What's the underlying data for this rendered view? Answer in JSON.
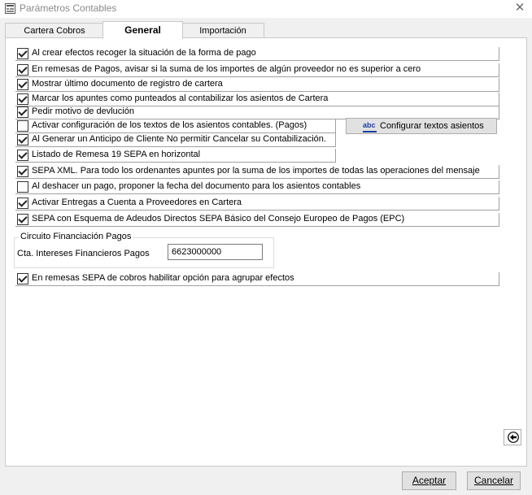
{
  "window": {
    "title": "Parámetros Contables",
    "close_icon": "close-icon",
    "app_icon": "app-icon"
  },
  "tabs": [
    {
      "label": "Cartera Cobros",
      "active": false
    },
    {
      "label": "General",
      "active": true
    },
    {
      "label": "Importación",
      "active": false
    }
  ],
  "options": [
    {
      "label": "Al crear efectos recoger la situación de la forma de pago",
      "checked": true
    },
    {
      "label": "En remesas de Pagos, avisar si la suma de los importes de algún proveedor no es superior a cero",
      "checked": true
    },
    {
      "label": "Mostrar último documento de registro de cartera",
      "checked": true
    },
    {
      "label": "Marcar los apuntes como punteados al contabilizar los asientos de Cartera",
      "checked": true
    },
    {
      "label": "Pedir motivo de devlución",
      "checked": true
    },
    {
      "label": "Activar configuración de los textos de los asientos contables. (Pagos)",
      "checked": false
    },
    {
      "label": "Al Generar un Anticipo de Cliente No permitir Cancelar su Contabilización.",
      "checked": true
    },
    {
      "label": "Listado de Remesa 19 SEPA en horizontal",
      "checked": true
    },
    {
      "label": "SEPA XML. Para todo los ordenantes apuntes por la suma de los importes de todas las operaciones del mensaje",
      "checked": true
    },
    {
      "label": "Al deshacer un pago, proponer la fecha del documento para los asientos contables",
      "checked": false
    },
    {
      "label": "Activar Entregas a Cuenta a Proveedores en Cartera",
      "checked": true
    },
    {
      "label": "SEPA con Esquema de Adeudos Directos SEPA Básico del Consejo Europeo de Pagos (EPC)",
      "checked": true
    },
    {
      "label": "En remesas SEPA de cobros habilitar opción para agrupar efectos",
      "checked": true
    }
  ],
  "config_button": {
    "label": "Configurar textos asientos",
    "icon": "abc-icon",
    "icon_text": "abc"
  },
  "financing_group": {
    "title": "Circuito Financiación Pagos",
    "field_label": "Cta. Intereses Financieros Pagos",
    "field_value": "6623000000"
  },
  "back_button": {
    "icon": "arrow-left-icon"
  },
  "footer": {
    "accept_label": "Aceptar",
    "cancel_label": "Cancelar"
  }
}
